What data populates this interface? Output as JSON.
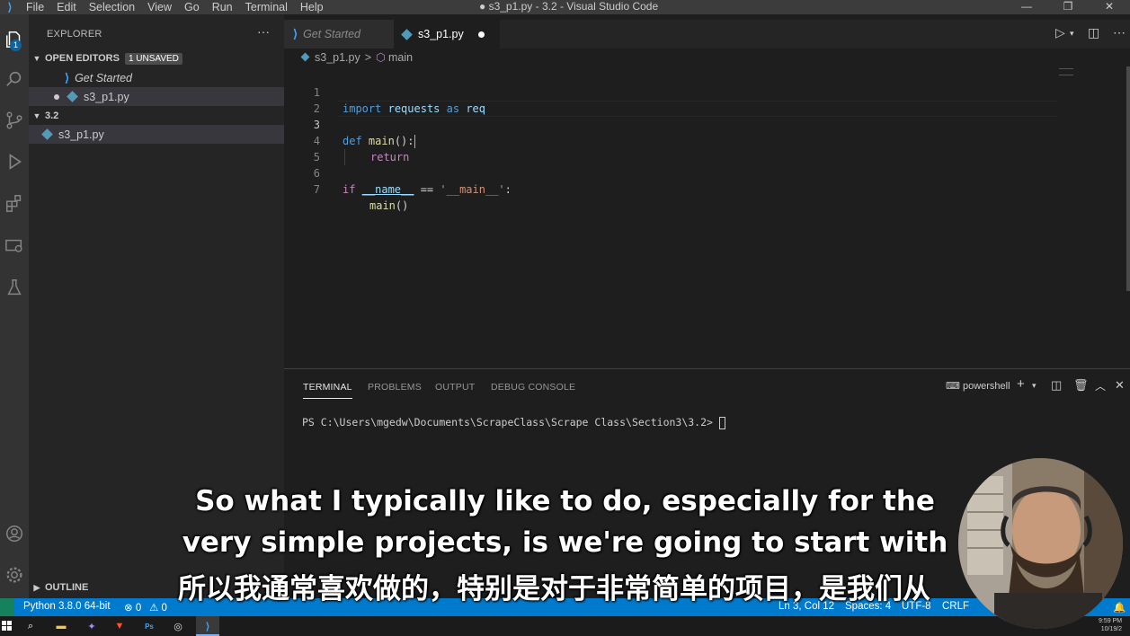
{
  "window": {
    "title": "● s3_p1.py - 3.2 - Visual Studio Code",
    "menu": [
      "File",
      "Edit",
      "Selection",
      "View",
      "Go",
      "Run",
      "Terminal",
      "Help"
    ],
    "controls": [
      "—",
      "❐",
      "✕"
    ]
  },
  "activity_bar": {
    "items": [
      "explorer-icon",
      "search-icon",
      "source-control-icon",
      "run-debug-icon",
      "extensions-icon",
      "remote-explorer-icon",
      "testing-icon",
      "accounts-icon",
      "settings-gear-icon"
    ],
    "explorer_badge": "1"
  },
  "sidebar": {
    "header": "EXPLORER",
    "more": "···",
    "open_editors": {
      "label": "OPEN EDITORS",
      "badge": "1 UNSAVED",
      "items": [
        {
          "label": "Get Started",
          "icon": "vscode-icon"
        },
        {
          "label": "s3_p1.py",
          "icon": "python-file-icon",
          "dirty": true
        }
      ]
    },
    "folder": {
      "label": "3.2",
      "items": [
        {
          "label": "s3_p1.py",
          "icon": "python-file-icon"
        }
      ]
    },
    "outline": "OUTLINE"
  },
  "tabs": [
    {
      "label": "Get Started",
      "active": false
    },
    {
      "label": "s3_p1.py",
      "active": true,
      "dirty": true
    }
  ],
  "breadcrumb": {
    "file": "s3_p1.py",
    "separator": ">",
    "symbol": "main"
  },
  "editor": {
    "line_numbers": [
      "1",
      "2",
      "3",
      "4",
      "5",
      "6",
      "7"
    ],
    "current_line": 3,
    "code": {
      "l1_import": "import",
      "l1_module": "requests",
      "l1_as": "as",
      "l1_alias": "req",
      "l3_def": "def",
      "l3_name": "main",
      "l3_rest": "():",
      "l4_return": "return",
      "l6_if": "if",
      "l6_name": "__name__",
      "l6_eq": " == ",
      "l6_str": "'__main__'",
      "l6_colon": ":",
      "l7_call": "main",
      "l7_parens": "()"
    }
  },
  "panel": {
    "tabs": [
      "TERMINAL",
      "PROBLEMS",
      "OUTPUT",
      "DEBUG CONSOLE"
    ],
    "active_tab": "TERMINAL",
    "shell": "powershell",
    "prompt": "PS C:\\Users\\mgedw\\Documents\\ScrapeClass\\Scrape Class\\Section3\\3.2> "
  },
  "status_bar": {
    "interpreter": "Python 3.8.0 64-bit",
    "errors": "⊗ 0",
    "warnings": "⚠ 0",
    "cursor": "Ln 3, Col 12",
    "spaces": "Spaces: 4",
    "encoding": "UTF-8",
    "eol": "CRLF"
  },
  "subtitles": {
    "en_line1": "So what I typically like to do, especially for the",
    "en_line2": "very simple projects, is we're going to start with",
    "zh_line": "所以我通常喜欢做的，特别是对于非常简单的项目，是我们从"
  },
  "taskbar": {
    "time": "9:59 PM",
    "date": "10/19/2"
  },
  "colors": {
    "status_bar": "#007acc",
    "activity_bar": "#333333",
    "sidebar": "#252526",
    "editor": "#1e1e1e",
    "keyword": "#569cd6",
    "function": "#dcdcaa",
    "string": "#ce9178"
  }
}
